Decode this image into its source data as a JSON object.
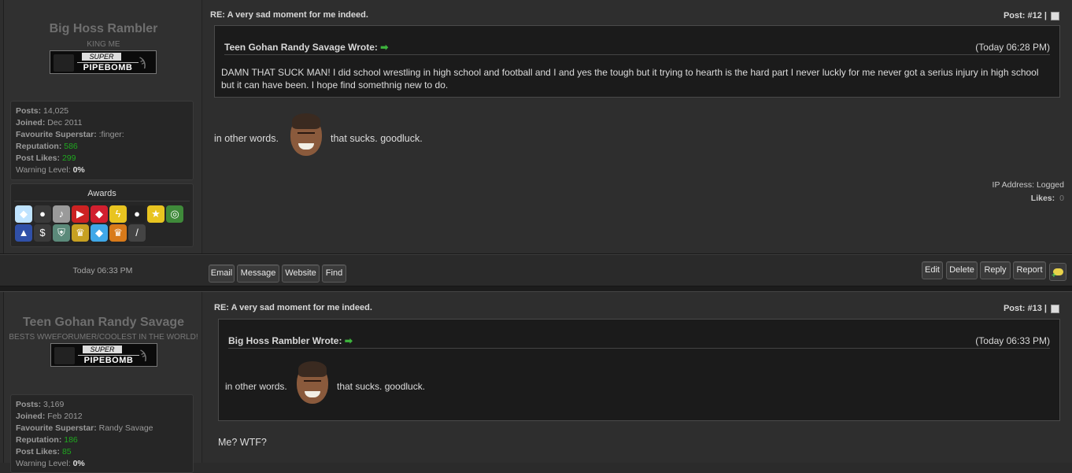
{
  "posts": [
    {
      "username": "Big Hoss Rambler",
      "usertitle": "KING ME",
      "badge": {
        "top": "SUPER",
        "bottom": "PIPEBOMB"
      },
      "stats": {
        "posts_label": "Posts:",
        "posts": "14,025",
        "joined_label": "Joined:",
        "joined": "Dec 2011",
        "superstar_label": "Favourite Superstar:",
        "superstar": ":finger:",
        "reputation_label": "Reputation:",
        "reputation": "586",
        "likes_label": "Post Likes:",
        "likes": "299",
        "warning_label": "Warning Level:",
        "warning": "0%"
      },
      "awards_title": "Awards",
      "title": "RE: A very sad moment for me indeed.",
      "post_number": "Post: #12 |",
      "quote": {
        "author": "Teen Gohan Randy Savage Wrote:",
        "time": "(Today 06:28 PM)",
        "text": "DAMN THAT SUCK MAN! I did school wrestling in high school and football and I and yes the tough but it trying to hearth is the hard part I never luckly for me never got a serius injury in high school but it can have been. I hope find somethnig new to do."
      },
      "message_before": "in other words.",
      "message_after": "that sucks. goodluck.",
      "ip": "IP Address: Logged",
      "likes_label": "Likes:",
      "likes_count": "0",
      "time": "Today 06:33 PM",
      "buttons_left": [
        "Email",
        "Message",
        "Website",
        "Find"
      ],
      "buttons_right": [
        "Edit",
        "Delete",
        "Reply",
        "Report"
      ]
    },
    {
      "username": "Teen Gohan Randy Savage",
      "usertitle": "BESTS WWEFORUMER/COOLEST IN THE WORLD!",
      "badge": {
        "top": "SUPER",
        "bottom": "PIPEBOMB"
      },
      "stats": {
        "posts_label": "Posts:",
        "posts": "3,169",
        "joined_label": "Joined:",
        "joined": "Feb 2012",
        "superstar_label": "Favourite Superstar:",
        "superstar": "Randy Savage",
        "reputation_label": "Reputation:",
        "reputation": "186",
        "likes_label": "Post Likes:",
        "likes": "85",
        "warning_label": "Warning Level:",
        "warning": "0%"
      },
      "title": "RE: A very sad moment for me indeed.",
      "post_number": "Post: #13 |",
      "quote": {
        "author": "Big Hoss Rambler Wrote:",
        "time": "(Today 06:33 PM)",
        "text_before": "in other words.",
        "text_after": "that sucks. goodluck."
      },
      "message": "Me? WTF?"
    }
  ],
  "award_icons": [
    {
      "icon": "diamond-icon",
      "color": "#bfe3ff",
      "glyph": "◆"
    },
    {
      "icon": "bomb-icon",
      "color": "#3a3a3a",
      "glyph": "●"
    },
    {
      "icon": "microphone-icon",
      "color": "#9a9a9a",
      "glyph": "♪"
    },
    {
      "icon": "youtube-icon",
      "color": "#cc2222",
      "glyph": "▶"
    },
    {
      "icon": "ruby-icon",
      "color": "#d11f2f",
      "glyph": "◆"
    },
    {
      "icon": "lightning-icon",
      "color": "#e8c420",
      "glyph": "ϟ"
    },
    {
      "icon": "ninja-icon",
      "color": "#222222",
      "glyph": "●"
    },
    {
      "icon": "star-icon",
      "color": "#e8c420",
      "glyph": "★"
    },
    {
      "icon": "chrome-icon",
      "color": "#3f8a3a",
      "glyph": "◎"
    },
    {
      "icon": "rocket-icon",
      "color": "#3050a8",
      "glyph": "▲"
    },
    {
      "icon": "dollar-icon",
      "color": "#3a3a3a",
      "glyph": "$"
    },
    {
      "icon": "shield-icon",
      "color": "#5b8a7a",
      "glyph": "⛨"
    },
    {
      "icon": "trophy-icon",
      "color": "#c7a021",
      "glyph": "♛"
    },
    {
      "icon": "blue-diamond-icon",
      "color": "#3fa8e8",
      "glyph": "◆"
    },
    {
      "icon": "crown-icon",
      "color": "#d87a1a",
      "glyph": "♛"
    },
    {
      "icon": "knife-icon",
      "color": "#444444",
      "glyph": "/"
    }
  ]
}
